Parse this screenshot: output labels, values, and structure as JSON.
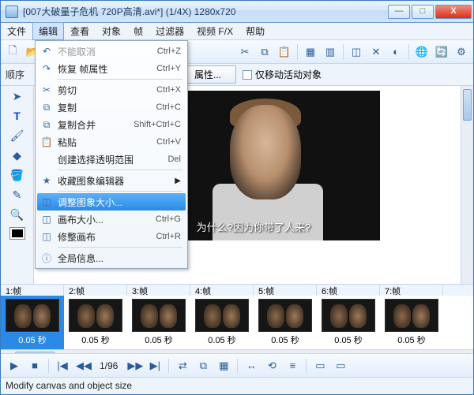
{
  "window": {
    "title": "[007大破量子危机 720P高清.avi*] (1/4X)  1280x720"
  },
  "menubar": {
    "items": [
      "文件",
      "编辑",
      "查看",
      "对象",
      "帧",
      "过滤器",
      "视频 F/X",
      "帮助"
    ],
    "openIndex": 1
  },
  "toolbar2": {
    "order": "顺序",
    "props": "属性...",
    "moveOnly": "仅移动活动对象"
  },
  "dropdown": {
    "rows": [
      {
        "icon": "↶",
        "label": "不能取消",
        "shortcut": "Ctrl+Z",
        "disabled": true
      },
      {
        "icon": "↷",
        "label": "恢复 帧属性",
        "shortcut": "Ctrl+Y"
      },
      {
        "sep": true
      },
      {
        "icon": "✂",
        "label": "剪切",
        "shortcut": "Ctrl+X"
      },
      {
        "icon": "⧉",
        "label": "复制",
        "shortcut": "Ctrl+C"
      },
      {
        "icon": "⧉",
        "label": "复制合并",
        "shortcut": "Shift+Ctrl+C"
      },
      {
        "icon": "📋",
        "label": "粘贴",
        "shortcut": "Ctrl+V"
      },
      {
        "icon": "",
        "label": "创建选择透明范围",
        "shortcut": "Del"
      },
      {
        "sep": true
      },
      {
        "icon": "★",
        "label": "收藏图象编辑器",
        "arrow": true
      },
      {
        "sep": true
      },
      {
        "icon": "◫",
        "label": "调整图象大小...",
        "hl": true
      },
      {
        "icon": "◫",
        "label": "画布大小...",
        "shortcut": "Ctrl+G"
      },
      {
        "icon": "◫",
        "label": "修整画布",
        "shortcut": "Ctrl+R"
      },
      {
        "sep": true
      },
      {
        "icon": "ⓘ",
        "label": "全局信息..."
      }
    ]
  },
  "video": {
    "subtitle": "为什么?因为你带了人来?"
  },
  "timeline": {
    "headers": [
      "1:帧",
      "2:帧",
      "3:帧",
      "4:帧",
      "5:帧",
      "6:帧",
      "7:帧"
    ],
    "duration": "0.05 秒"
  },
  "playbar": {
    "counter": "1/96"
  },
  "status": "Modify canvas and object size"
}
